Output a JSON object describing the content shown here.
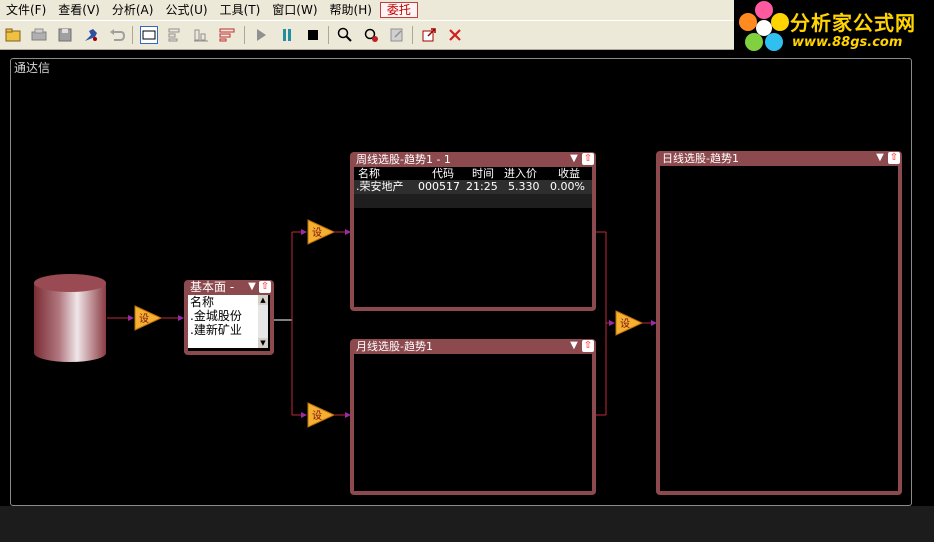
{
  "menu": {
    "items": [
      "文件(F)",
      "查看(V)",
      "分析(A)",
      "公式(U)",
      "工具(T)",
      "窗口(W)",
      "帮助(H)"
    ],
    "special": "委托"
  },
  "toolbar": {
    "icons": [
      "open-folder-icon",
      "print-icon",
      "save-icon",
      "connect-icon",
      "undo-icon",
      "rectangle-select-icon",
      "align-left-icon",
      "align-bottom-icon",
      "align-tree-icon",
      "play-icon",
      "pause-icon",
      "stop-icon",
      "search-icon",
      "find-icon",
      "export-icon",
      "new-window-icon",
      "close-icon"
    ]
  },
  "logo": {
    "title": "分析家公式网",
    "url": "www.88gs.com"
  },
  "workspace": {
    "title": "通达信"
  },
  "filter_label": "设",
  "panel_fundamental": {
    "title": "基本面 -",
    "header": "名称",
    "items": [
      ".金城股份",
      ".建新矿业"
    ]
  },
  "panel_weekly": {
    "title": "周线选股-趋势1 - 1",
    "columns": [
      "名称",
      "代码",
      "时间",
      "进入价",
      "收益"
    ],
    "rows": [
      [
        ".荣安地产",
        "000517",
        "21:25",
        "5.330",
        "0.00%"
      ]
    ]
  },
  "panel_monthly": {
    "title": "月线选股-趋势1"
  },
  "panel_daily": {
    "title": "日线选股-趋势1"
  },
  "colors": {
    "panel": "#8c4a4e",
    "wire": "#c0283a",
    "filter": "#f4b030",
    "arrow": "#9b2aa8"
  }
}
